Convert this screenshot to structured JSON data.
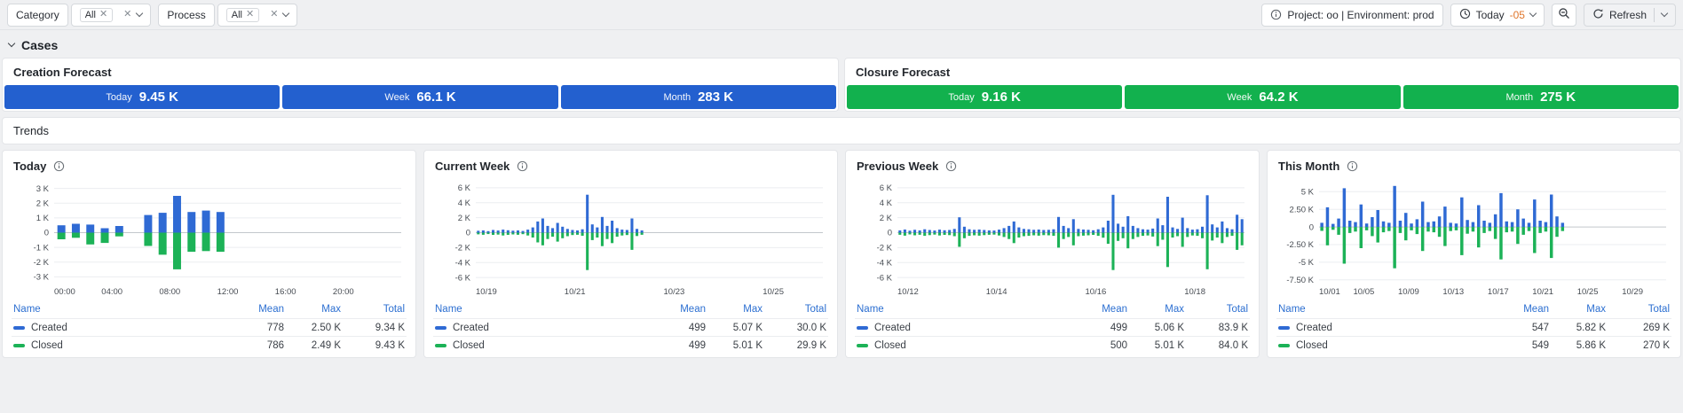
{
  "topbar": {
    "filters": [
      {
        "label": "Category",
        "chip": "All"
      },
      {
        "label": "Process",
        "chip": "All"
      }
    ],
    "project_env": "Project: oo | Environment: prod",
    "time_label": "Today",
    "time_offset": "-05",
    "refresh_label": "Refresh"
  },
  "section_title": "Cases",
  "trends_title": "Trends",
  "colors": {
    "created": "#2f6ad4",
    "closed": "#1cb257"
  },
  "forecasts": [
    {
      "title": "Creation Forecast",
      "color": "#2360cf",
      "items": [
        {
          "label": "Today",
          "value": "9.45 K"
        },
        {
          "label": "Week",
          "value": "66.1 K"
        },
        {
          "label": "Month",
          "value": "283 K"
        }
      ]
    },
    {
      "title": "Closure Forecast",
      "color": "#12b14e",
      "items": [
        {
          "label": "Today",
          "value": "9.16 K"
        },
        {
          "label": "Week",
          "value": "64.2 K"
        },
        {
          "label": "Month",
          "value": "275 K"
        }
      ]
    }
  ],
  "table_headers": [
    "Name",
    "Mean",
    "Max",
    "Total"
  ],
  "chart_data": [
    {
      "type": "bar",
      "title": "Today",
      "ymin": -3400,
      "ymax": 3400,
      "yticks": [
        [
          3000,
          "3 K"
        ],
        [
          2000,
          "2 K"
        ],
        [
          1000,
          "1 K"
        ],
        [
          0,
          "0"
        ],
        [
          -1000,
          "-1 K"
        ],
        [
          -2000,
          "-2 K"
        ],
        [
          -3000,
          "-3 K"
        ]
      ],
      "xticks": [
        [
          0,
          "00:00"
        ],
        [
          0.1667,
          "04:00"
        ],
        [
          0.3333,
          "08:00"
        ],
        [
          0.5,
          "12:00"
        ],
        [
          0.6667,
          "16:00"
        ],
        [
          0.8333,
          "20:00"
        ]
      ],
      "series": [
        {
          "name": "Created",
          "values": [
            500,
            600,
            550,
            300,
            450,
            0,
            1200,
            1350,
            2500,
            1400,
            1500,
            1400,
            0,
            0,
            0,
            0,
            0,
            0,
            0,
            0,
            0,
            0,
            0,
            0
          ]
        },
        {
          "name": "Closed",
          "values": [
            450,
            350,
            800,
            700,
            250,
            0,
            900,
            1500,
            2490,
            1300,
            1250,
            1300,
            0,
            0,
            0,
            0,
            0,
            0,
            0,
            0,
            0,
            0,
            0,
            0
          ]
        }
      ],
      "table": [
        {
          "name": "Created",
          "mean": "778",
          "max": "2.50 K",
          "total": "9.34 K"
        },
        {
          "name": "Closed",
          "mean": "786",
          "max": "2.49 K",
          "total": "9.43 K"
        }
      ]
    },
    {
      "type": "bar",
      "title": "Current Week",
      "ymin": -6700,
      "ymax": 6700,
      "yticks": [
        [
          6000,
          "6 K"
        ],
        [
          4000,
          "4 K"
        ],
        [
          2000,
          "2 K"
        ],
        [
          0,
          "0"
        ],
        [
          -2000,
          "-2 K"
        ],
        [
          -4000,
          "-4 K"
        ],
        [
          -6000,
          "-6 K"
        ]
      ],
      "xticks": [
        [
          0,
          "10/19"
        ],
        [
          0.2857,
          "10/21"
        ],
        [
          0.5714,
          "10/23"
        ],
        [
          0.8571,
          "10/25"
        ]
      ],
      "series": [
        {
          "name": "Created",
          "values": [
            250,
            300,
            200,
            350,
            280,
            400,
            320,
            260,
            300,
            220,
            400,
            700,
            1500,
            1900,
            900,
            600,
            1300,
            800,
            500,
            350,
            300,
            450,
            5070,
            1100,
            700,
            2100,
            900,
            1600,
            600,
            400,
            350,
            1900,
            500,
            300,
            0,
            0,
            0,
            0,
            0,
            0,
            0,
            0,
            0,
            0,
            0,
            0,
            0,
            0,
            0,
            0,
            0,
            0,
            0,
            0,
            0,
            0,
            0,
            0,
            0,
            0,
            0,
            0,
            0,
            0,
            0,
            0,
            0,
            0,
            0,
            0
          ]
        },
        {
          "name": "Closed",
          "values": [
            230,
            280,
            190,
            300,
            260,
            380,
            300,
            240,
            280,
            200,
            380,
            650,
            1300,
            1700,
            850,
            550,
            1200,
            750,
            480,
            320,
            280,
            420,
            5010,
            1000,
            650,
            1800,
            850,
            1400,
            550,
            380,
            320,
            2300,
            450,
            280,
            0,
            0,
            0,
            0,
            0,
            0,
            0,
            0,
            0,
            0,
            0,
            0,
            0,
            0,
            0,
            0,
            0,
            0,
            0,
            0,
            0,
            0,
            0,
            0,
            0,
            0,
            0,
            0,
            0,
            0,
            0,
            0,
            0,
            0,
            0,
            0
          ]
        }
      ],
      "table": [
        {
          "name": "Created",
          "mean": "499",
          "max": "5.07 K",
          "total": "30.0 K"
        },
        {
          "name": "Closed",
          "mean": "499",
          "max": "5.01 K",
          "total": "29.9 K"
        }
      ]
    },
    {
      "type": "bar",
      "title": "Previous Week",
      "ymin": -6700,
      "ymax": 6700,
      "yticks": [
        [
          6000,
          "6 K"
        ],
        [
          4000,
          "4 K"
        ],
        [
          2000,
          "2 K"
        ],
        [
          0,
          "0"
        ],
        [
          -2000,
          "-2 K"
        ],
        [
          -4000,
          "-4 K"
        ],
        [
          -6000,
          "-6 K"
        ]
      ],
      "xticks": [
        [
          0,
          "10/12"
        ],
        [
          0.2857,
          "10/14"
        ],
        [
          0.5714,
          "10/16"
        ],
        [
          0.8571,
          "10/18"
        ]
      ],
      "series": [
        {
          "name": "Created",
          "values": [
            300,
            420,
            260,
            380,
            300,
            450,
            350,
            280,
            400,
            320,
            350,
            500,
            2050,
            800,
            450,
            380,
            420,
            350,
            300,
            280,
            400,
            600,
            900,
            1500,
            700,
            500,
            450,
            380,
            420,
            350,
            380,
            450,
            2100,
            900,
            600,
            1800,
            500,
            420,
            380,
            320,
            450,
            700,
            1600,
            5060,
            1200,
            800,
            2200,
            900,
            600,
            450,
            400,
            550,
            1900,
            1000,
            4800,
            700,
            500,
            2000,
            600,
            400,
            450,
            800,
            5000,
            1100,
            700,
            1500,
            600,
            450,
            2400,
            1800
          ]
        },
        {
          "name": "Closed",
          "values": [
            280,
            400,
            240,
            360,
            280,
            430,
            330,
            260,
            380,
            300,
            330,
            480,
            1900,
            750,
            430,
            360,
            400,
            330,
            280,
            260,
            380,
            580,
            850,
            1400,
            650,
            480,
            430,
            360,
            400,
            330,
            360,
            430,
            2000,
            850,
            580,
            1700,
            480,
            400,
            360,
            300,
            430,
            680,
            1500,
            5010,
            1100,
            750,
            2100,
            850,
            580,
            430,
            380,
            520,
            1800,
            950,
            4600,
            650,
            480,
            1900,
            580,
            380,
            430,
            750,
            4900,
            1050,
            650,
            1400,
            580,
            430,
            2300,
            1700
          ]
        }
      ],
      "table": [
        {
          "name": "Created",
          "mean": "499",
          "max": "5.06 K",
          "total": "83.9 K"
        },
        {
          "name": "Closed",
          "mean": "500",
          "max": "5.01 K",
          "total": "84.0 K"
        }
      ]
    },
    {
      "type": "bar",
      "title": "This Month",
      "ymin": -7900,
      "ymax": 6300,
      "yticks": [
        [
          5000,
          "5 K"
        ],
        [
          2500,
          "2.50 K"
        ],
        [
          0,
          "0"
        ],
        [
          -2500,
          "-2.50 K"
        ],
        [
          -5000,
          "-5 K"
        ],
        [
          -7500,
          "-7.50 K"
        ]
      ],
      "xticks": [
        [
          0,
          "10/01"
        ],
        [
          0.129,
          "10/05"
        ],
        [
          0.258,
          "10/09"
        ],
        [
          0.387,
          "10/13"
        ],
        [
          0.516,
          "10/17"
        ],
        [
          0.645,
          "10/21"
        ],
        [
          0.774,
          "10/25"
        ],
        [
          0.903,
          "10/29"
        ]
      ],
      "series": [
        {
          "name": "Created",
          "values": [
            600,
            2800,
            450,
            1200,
            5500,
            900,
            700,
            3200,
            500,
            1400,
            2400,
            800,
            600,
            5820,
            900,
            2000,
            500,
            1100,
            3600,
            700,
            800,
            1500,
            2900,
            600,
            500,
            4200,
            1000,
            700,
            3100,
            900,
            600,
            1800,
            4800,
            800,
            700,
            2500,
            1200,
            600,
            3900,
            900,
            700,
            4600,
            1500,
            600,
            0,
            0,
            0,
            0,
            0,
            0,
            0,
            0,
            0,
            0,
            0,
            0,
            0,
            0,
            0,
            0,
            0,
            0
          ]
        },
        {
          "name": "Closed",
          "values": [
            550,
            2600,
            400,
            1100,
            5200,
            850,
            650,
            3000,
            480,
            1300,
            2200,
            750,
            580,
            5860,
            850,
            1900,
            480,
            1000,
            3400,
            650,
            750,
            1400,
            2700,
            580,
            480,
            4000,
            950,
            650,
            2900,
            850,
            580,
            1700,
            4600,
            750,
            650,
            2400,
            1100,
            580,
            3700,
            850,
            650,
            4400,
            1400,
            580,
            0,
            0,
            0,
            0,
            0,
            0,
            0,
            0,
            0,
            0,
            0,
            0,
            0,
            0,
            0,
            0,
            0,
            0
          ]
        }
      ],
      "table": [
        {
          "name": "Created",
          "mean": "547",
          "max": "5.82 K",
          "total": "269 K"
        },
        {
          "name": "Closed",
          "mean": "549",
          "max": "5.86 K",
          "total": "270 K"
        }
      ]
    }
  ]
}
